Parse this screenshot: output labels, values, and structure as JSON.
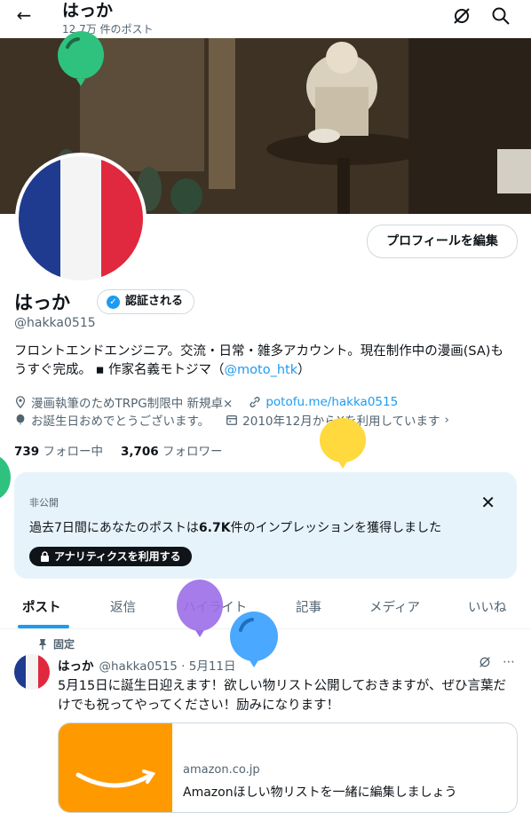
{
  "header": {
    "title": "はっか",
    "post_count": "12.7万 件のポスト"
  },
  "profile": {
    "name": "はっか",
    "verified_label": "認証される",
    "handle": "@hakka0515",
    "edit_button": "プロフィールを編集",
    "bio_text": "フロントエンドエンジニア。交流・日常・雑多アカウント。現在制作中の漫画(SA)もうすぐ完成。 ▪ 作家名義モトジマ（",
    "bio_link": "@moto_htk",
    "bio_end": "）",
    "location": "漫画執筆のためTRPG制限中 新規卓×",
    "website": "potofu.me/hakka0515",
    "birthday": "お誕生日おめでとうございます。",
    "joined": "2010年12月からXを利用しています",
    "following_count": "739",
    "following_label": "フォロー中",
    "followers_count": "3,706",
    "followers_label": "フォロワー"
  },
  "notice": {
    "private_label": "非公開",
    "message_pre": "過去7日間にあなたのポストは",
    "message_num": "6.7K",
    "message_post": "件のインプレッションを獲得しました",
    "button_label": "アナリティクスを利用する"
  },
  "tabs": [
    "ポスト",
    "返信",
    "ハイライト",
    "記事",
    "メディア",
    "いいね"
  ],
  "post": {
    "pinned_label": "固定",
    "author": "はっか",
    "handle_date": "@hakka0515 · 5月11日",
    "text": "5月15日に誕生日迎えます！欲しい物リスト公開しておきますが、ぜひ言葉だけでも祝ってやってください！励みになります！",
    "card_domain": "amazon.co.jp",
    "card_title": "Amazonほしい物リストを一緒に編集しましょう"
  },
  "colors": {
    "accent": "#1d9bf0",
    "flag_blue": "#1f3b8f",
    "flag_red": "#e0283e",
    "balloon_green": "#2ec27e",
    "balloon_yellow": "#ffd93d",
    "balloon_purple": "#9b6ee8",
    "balloon_blue": "#4aa8ff"
  }
}
